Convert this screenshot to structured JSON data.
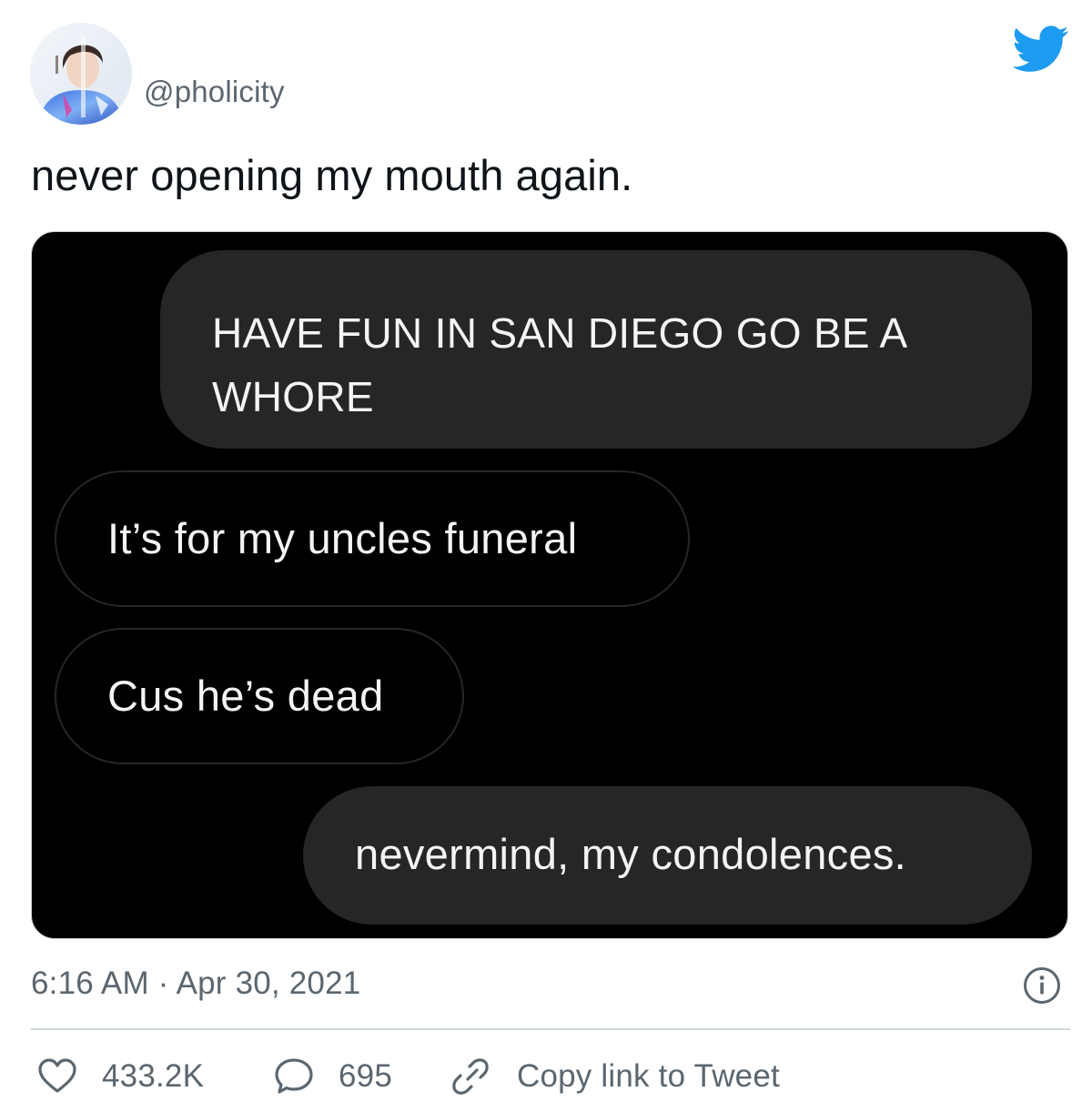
{
  "tweet": {
    "handle": "@pholicity",
    "text": "never opening my mouth again.",
    "timestamp": "6:16 AM · Apr 30, 2021"
  },
  "media": {
    "messages": [
      {
        "direction": "sent",
        "text": "HAVE FUN IN SAN DIEGO GO BE A WHORE"
      },
      {
        "direction": "received",
        "text": "It’s for my uncles funeral"
      },
      {
        "direction": "received",
        "text": "Cus he’s dead"
      },
      {
        "direction": "sent",
        "text": "nevermind, my condolences."
      }
    ]
  },
  "actions": {
    "likes": "433.2K",
    "replies": "695",
    "copy_link": "Copy link to Tweet"
  },
  "icons": {
    "brand": "twitter-bird-icon",
    "info": "info-icon",
    "like": "heart-icon",
    "reply": "speech-bubble-icon",
    "copy": "link-icon"
  },
  "colors": {
    "brand_blue": "#1d9bf0",
    "secondary_text": "#5b6670",
    "bubble_dark": "#262626",
    "media_background": "#000000"
  }
}
